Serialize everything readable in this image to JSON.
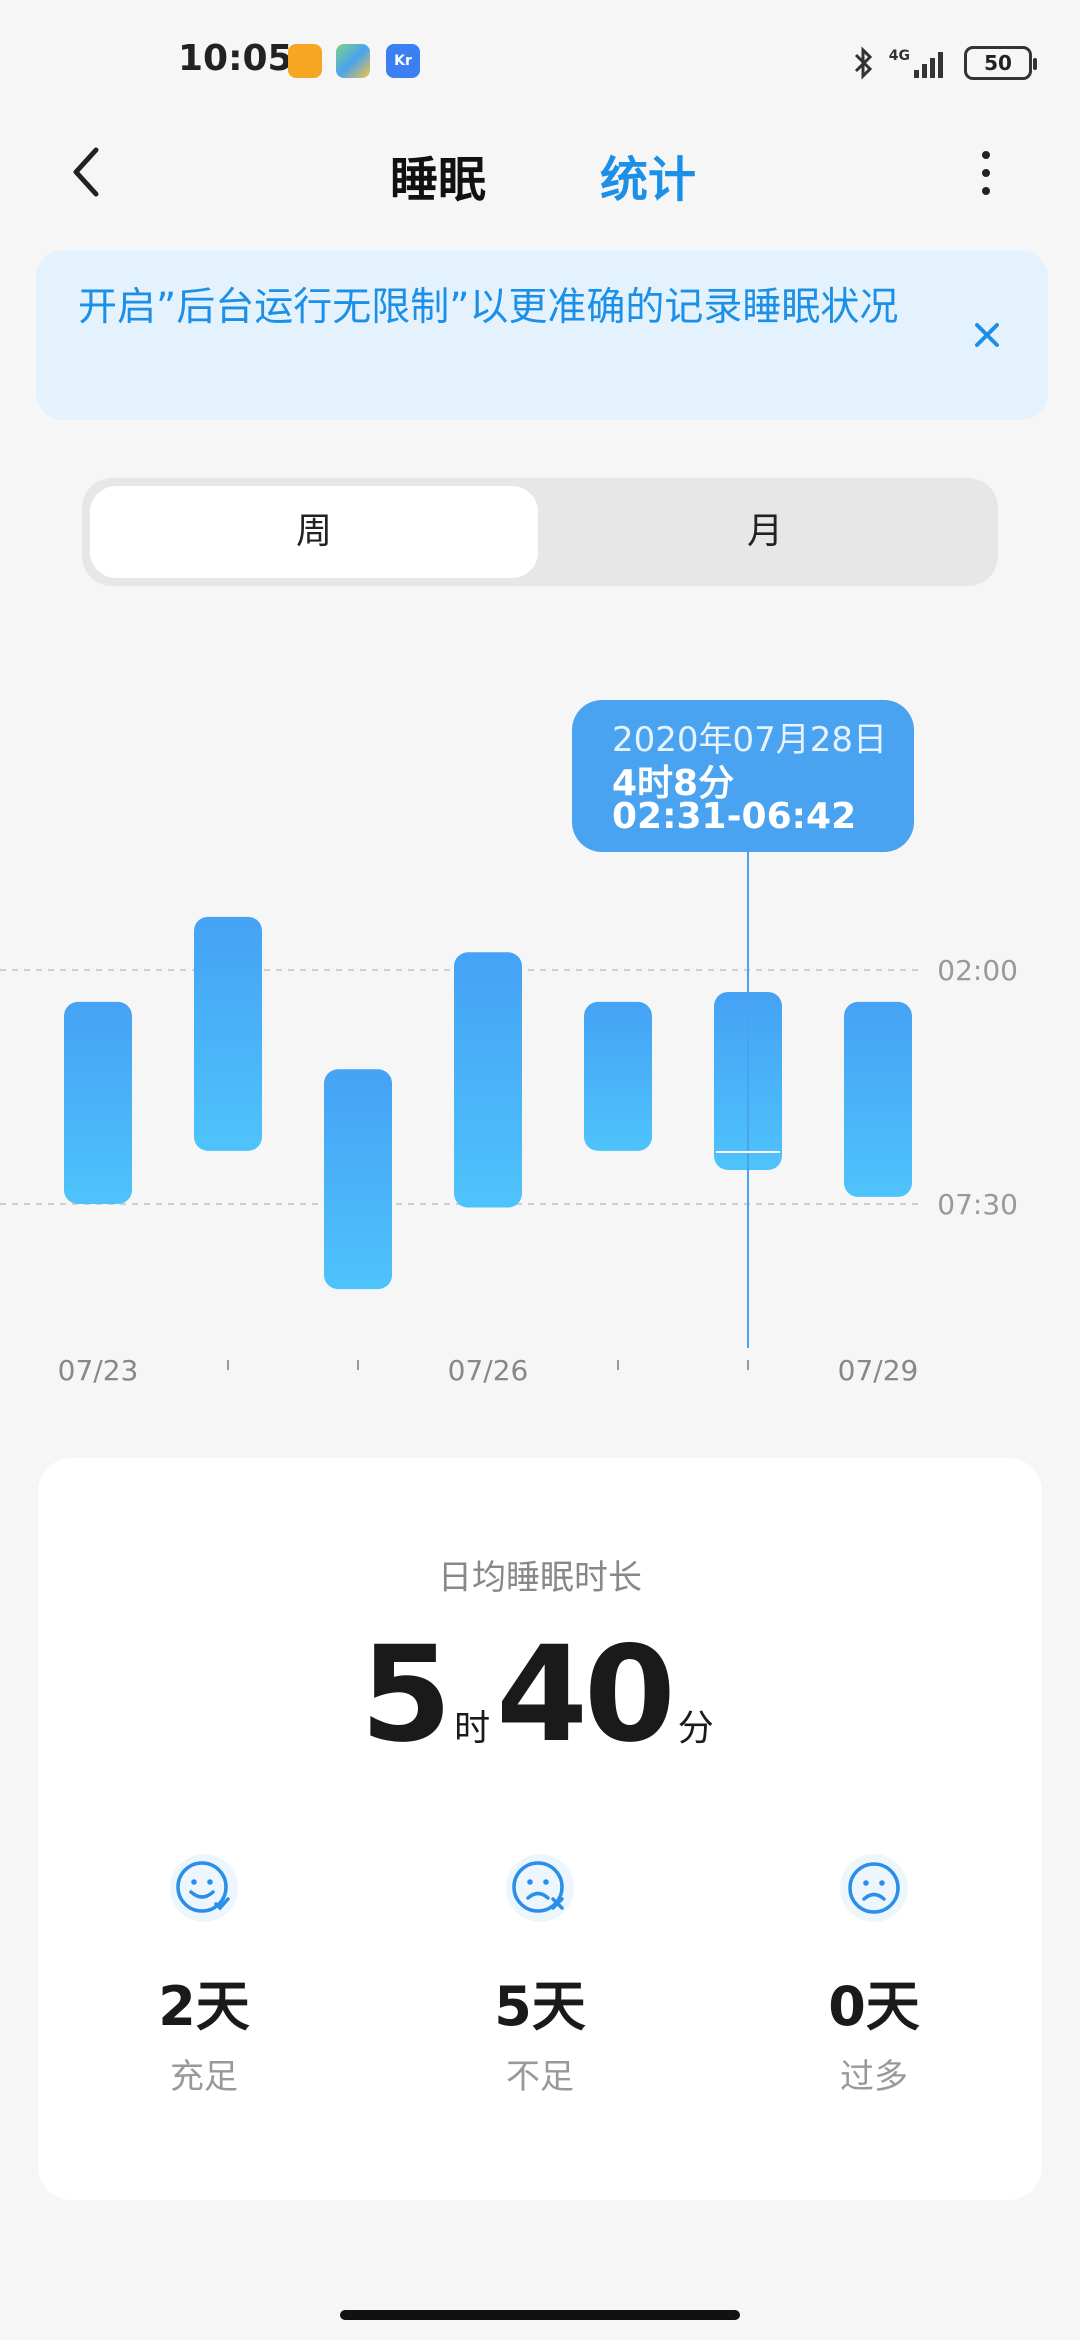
{
  "status_bar": {
    "time": "10:05",
    "network": "4G",
    "battery": "50",
    "icons": [
      "bluetooth-icon",
      "signal-icon",
      "battery-icon"
    ]
  },
  "header": {
    "back_icon": "chevron-left-icon",
    "title": "睡眠",
    "stats_tab": "统计",
    "more_icon": "more-vertical-icon"
  },
  "banner": {
    "text": "开启”后台运行无限制”以更准确的记录睡眠状况",
    "close_icon": "close-icon"
  },
  "segment": {
    "week": "周",
    "month": "月",
    "selected": "周"
  },
  "chart_data": {
    "type": "bar",
    "subtype": "floating-range",
    "y_axis_labels": [
      "02:00",
      "07:30"
    ],
    "x_tick_labels": [
      "07/23",
      "07/26",
      "07/29"
    ],
    "bars": [
      {
        "date": "07/23",
        "start": "02:45",
        "end": "07:30"
      },
      {
        "date": "07/24",
        "start": "00:45",
        "end": "06:15"
      },
      {
        "date": "07/25",
        "start": "04:20",
        "end": "09:30"
      },
      {
        "date": "07/26",
        "start": "01:35",
        "end": "07:35"
      },
      {
        "date": "07/27",
        "start": "02:45",
        "end": "06:15"
      },
      {
        "date": "07/28",
        "start": "02:31",
        "end": "06:42"
      },
      {
        "date": "07/29",
        "start": "02:45",
        "end": "07:20"
      }
    ],
    "selected_index": 5,
    "tooltip": {
      "date": "2020年07月28日",
      "duration": "4时8分",
      "range": "02:31-06:42"
    },
    "colors": {
      "bar_top": "#45a2f5",
      "bar_bottom": "#4ec3fb",
      "gridline": "#cfcfcf"
    }
  },
  "summary": {
    "label": "日均睡眠时长",
    "hours": "5",
    "hours_unit": "时",
    "minutes": "40",
    "minutes_unit": "分",
    "stats": [
      {
        "value": "2天",
        "label": "充足",
        "icon": "smile-check-icon"
      },
      {
        "value": "5天",
        "label": "不足",
        "icon": "frown-x-icon"
      },
      {
        "value": "0天",
        "label": "过多",
        "icon": "frown-icon"
      }
    ]
  },
  "accent_color": "#1c8fe6"
}
